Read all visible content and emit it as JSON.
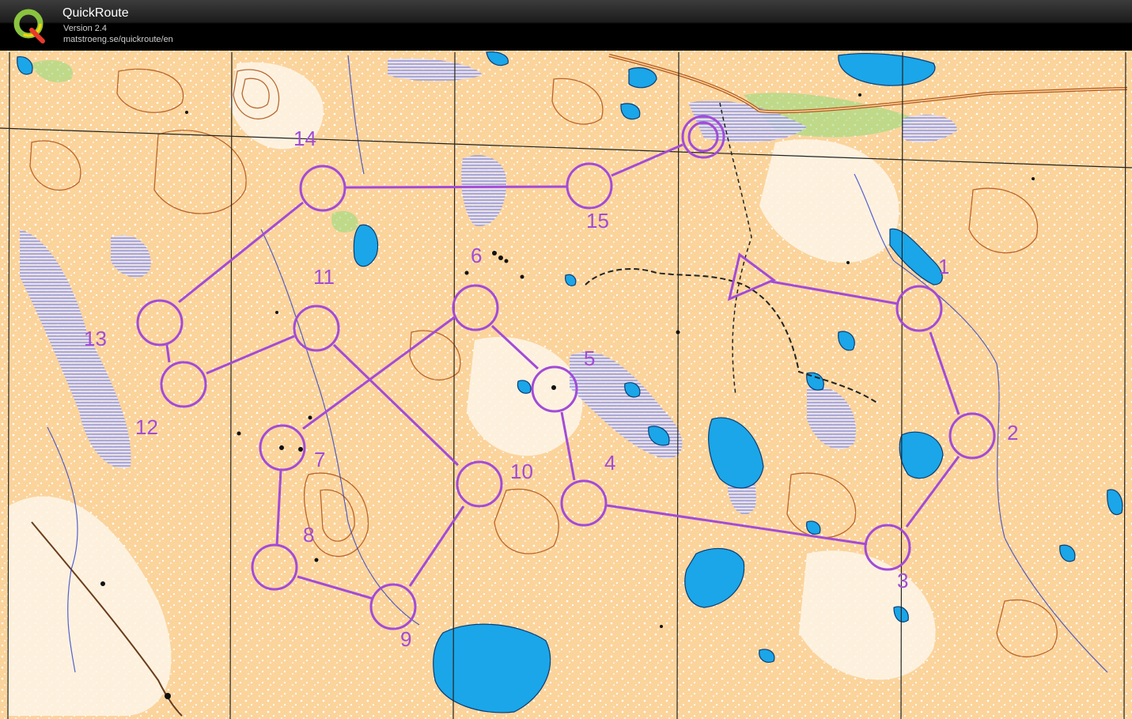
{
  "app": {
    "name": "QuickRoute",
    "version": "Version 2.4",
    "url": "matstroeng.se/quickroute/en"
  },
  "course": {
    "start_label": "",
    "finish_label": "",
    "controls": [
      {
        "label": "1"
      },
      {
        "label": "2"
      },
      {
        "label": "3"
      },
      {
        "label": "4"
      },
      {
        "label": "5"
      },
      {
        "label": "6"
      },
      {
        "label": "7"
      },
      {
        "label": "8"
      },
      {
        "label": "9"
      },
      {
        "label": "10"
      },
      {
        "label": "11"
      },
      {
        "label": "12"
      },
      {
        "label": "13"
      },
      {
        "label": "14"
      },
      {
        "label": "15"
      }
    ]
  },
  "colors": {
    "course": "#a24bd8",
    "open_land": "#fbd49c",
    "forest": "#ffffff",
    "water": "#1aa6e8",
    "marsh": "#6a74d8",
    "contour": "#b35a1f",
    "vegetation": "#8fdc7a",
    "magnetic_north": "#222222"
  }
}
